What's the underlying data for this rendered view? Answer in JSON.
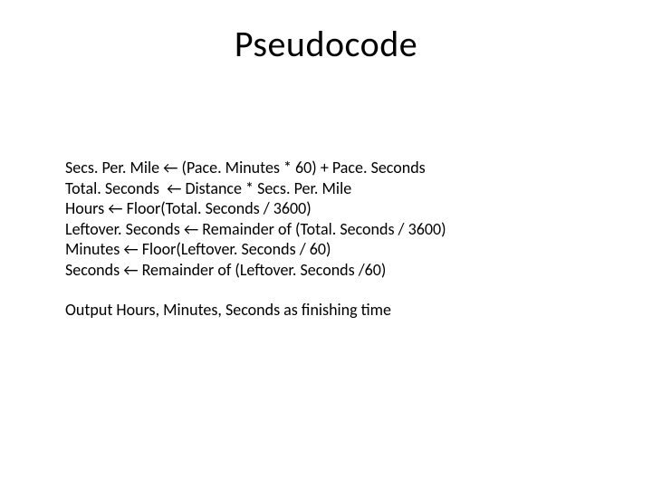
{
  "title": "Pseudocode",
  "lines": {
    "l1": "Secs. Per. Mile ← (Pace. Minutes * 60) + Pace. Seconds",
    "l2": "Total. Seconds  ← Distance * Secs. Per. Mile",
    "l3": "Hours ← Floor(Total. Seconds / 3600)",
    "l4": "Leftover. Seconds ← Remainder of (Total. Seconds / 3600)",
    "l5": "Minutes ← Floor(Leftover. Seconds / 60)",
    "l6": "Seconds ← Remainder of (Leftover. Seconds /60)"
  },
  "output_line": "Output Hours, Minutes, Seconds as finishing time"
}
